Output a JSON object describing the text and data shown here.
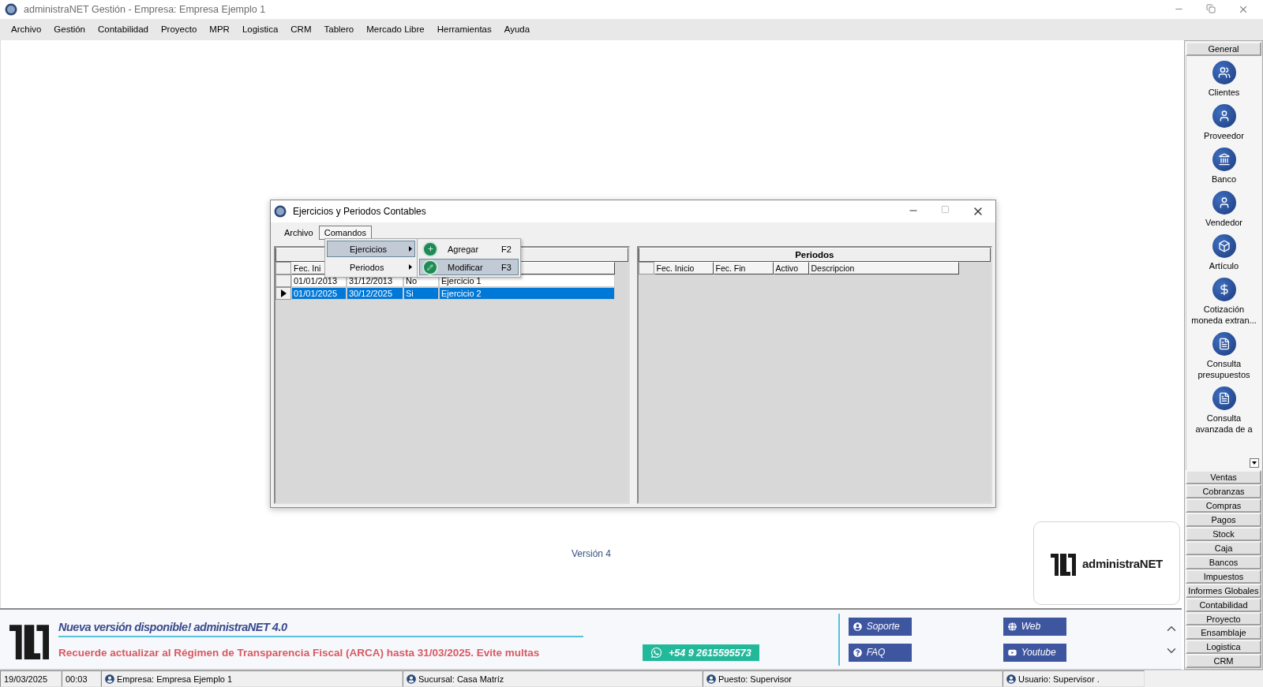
{
  "window": {
    "title": "administraNET Gestión - Empresa: Empresa Ejemplo 1"
  },
  "menu": [
    "Archivo",
    "Gestión",
    "Contabilidad",
    "Proyecto",
    "MPR",
    "Logistica",
    "CRM",
    "Tablero",
    "Mercado Libre",
    "Herramientas",
    "Ayuda"
  ],
  "workspace": {
    "version": "Versión 4",
    "brand": "administraNET"
  },
  "dialog": {
    "title": "Ejercicios y Periodos Contables",
    "menu": [
      {
        "label": "Archivo",
        "selected": false
      },
      {
        "label": "Comandos",
        "selected": true
      }
    ],
    "commands_menu": [
      {
        "label": "Ejercicios",
        "selected": true
      },
      {
        "label": "Periodos",
        "selected": false
      }
    ],
    "submenu": [
      {
        "label": "Agregar",
        "shortcut": "F2",
        "selected": false
      },
      {
        "label": "Modificar",
        "shortcut": "F3",
        "selected": true
      }
    ],
    "ejercicios": {
      "columns": [
        "Fec. Ini"
      ],
      "rows": [
        {
          "cells": [
            "01/01/2013",
            "31/12/2013",
            "No",
            "Ejercicio 1"
          ],
          "selected": false
        },
        {
          "cells": [
            "01/01/2025",
            "30/12/2025",
            "Si",
            "Ejercicio 2"
          ],
          "selected": true
        }
      ]
    },
    "periodos": {
      "title": "Periodos",
      "columns": [
        "Fec. Inicio",
        "Fec. Fin",
        "Activo",
        "Descripcion"
      ]
    }
  },
  "sidebar": {
    "header": "General",
    "items": [
      "Clientes",
      "Proveedor",
      "Banco",
      "Vendedor",
      "Artículo",
      "Cotización moneda extran...",
      "Consulta presupuestos",
      "Consulta avanzada de a"
    ],
    "groups": [
      "Ventas",
      "Cobranzas",
      "Compras",
      "Pagos",
      "Stock",
      "Caja",
      "Bancos",
      "Impuestos",
      "Informes Globales",
      "Contabilidad",
      "Proyecto",
      "Ensamblaje",
      "Logistica",
      "CRM"
    ]
  },
  "banner": {
    "title": "Nueva versión disponible! administraNET 4.0",
    "notice": "Recuerde actualizar al Régimen de Transparencia Fiscal (ARCA) hasta 31/03/2025. Evite multas",
    "whatsapp": "+54 9 2615595573",
    "links": [
      "Soporte",
      "Web",
      "FAQ",
      "Youtube"
    ]
  },
  "status_bar": [
    {
      "kind": "plain",
      "text": "19/03/2025"
    },
    {
      "kind": "plain",
      "text": "00:03"
    },
    {
      "kind": "icon",
      "text": "Empresa: Empresa Ejemplo 1"
    },
    {
      "kind": "icon",
      "text": "Sucursal: Casa Matríz"
    },
    {
      "kind": "icon",
      "text": "Puesto: Supervisor"
    },
    {
      "kind": "icon",
      "text": "Usuario: Supervisor ."
    }
  ]
}
